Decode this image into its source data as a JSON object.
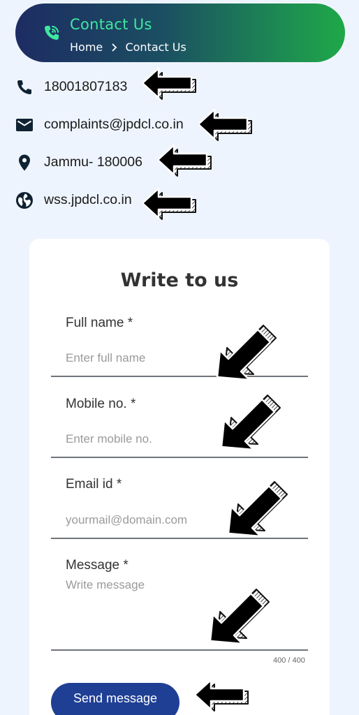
{
  "header": {
    "title": "Contact Us",
    "breadcrumb_home": "Home",
    "breadcrumb_current": "Contact Us",
    "icon": "phone-wifi-icon"
  },
  "contact": {
    "phone": "18001807183",
    "email": "complaints@jpdcl.co.in",
    "location": "Jammu- 180006",
    "website": "wss.jpdcl.co.in",
    "icons": [
      "phone-icon",
      "email-icon",
      "location-pin-icon",
      "globe-icon"
    ]
  },
  "form": {
    "title": "Write to us",
    "full_name_label": "Full name *",
    "full_name_placeholder": "Enter full name",
    "mobile_label": "Mobile no. *",
    "mobile_placeholder": "Enter mobile no.",
    "email_label": "Email id *",
    "email_placeholder": "yourmail@domain.com",
    "message_label": "Message *",
    "message_placeholder": "Write message",
    "counter": "400 / 400",
    "send_label": "Send message"
  },
  "colors": {
    "accent_green": "#3ee8a0",
    "button_blue": "#1f3f94",
    "page_bg": "#eef4fd"
  }
}
